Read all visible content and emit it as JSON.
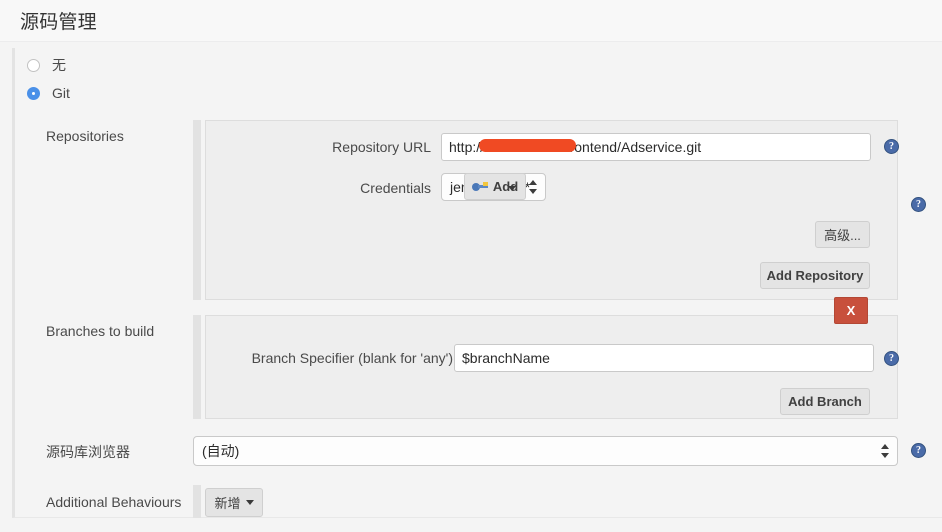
{
  "header": {
    "title": "源码管理"
  },
  "scm_options": [
    {
      "label": "无",
      "selected": false
    },
    {
      "label": "Git",
      "selected": true
    }
  ],
  "repositories": {
    "section_label": "Repositories",
    "repository_url": {
      "label": "Repository URL",
      "value": "http://1                4/frontend/Adservice.git",
      "redacted": true
    },
    "credentials": {
      "label": "Credentials",
      "selected": "jenkins/******"
    },
    "add_credentials_button": "Add",
    "advanced_button": "高级...",
    "add_repository_button": "Add Repository"
  },
  "branches": {
    "section_label": "Branches to build",
    "branch_specifier": {
      "label": "Branch Specifier (blank for 'any')",
      "value": "$branchName"
    },
    "delete_button": "X",
    "add_branch_button": "Add Branch"
  },
  "repository_browser": {
    "label": "源码库浏览器",
    "selected": "(自动)"
  },
  "additional_behaviours": {
    "label": "Additional Behaviours",
    "add_button": "新增"
  },
  "help_icon_glyph": "?",
  "colors": {
    "accent_blue": "#4a90e8",
    "delete_red": "#c8503c",
    "redaction_orange": "#f04a23",
    "help_blue": "#4a6ba8"
  }
}
